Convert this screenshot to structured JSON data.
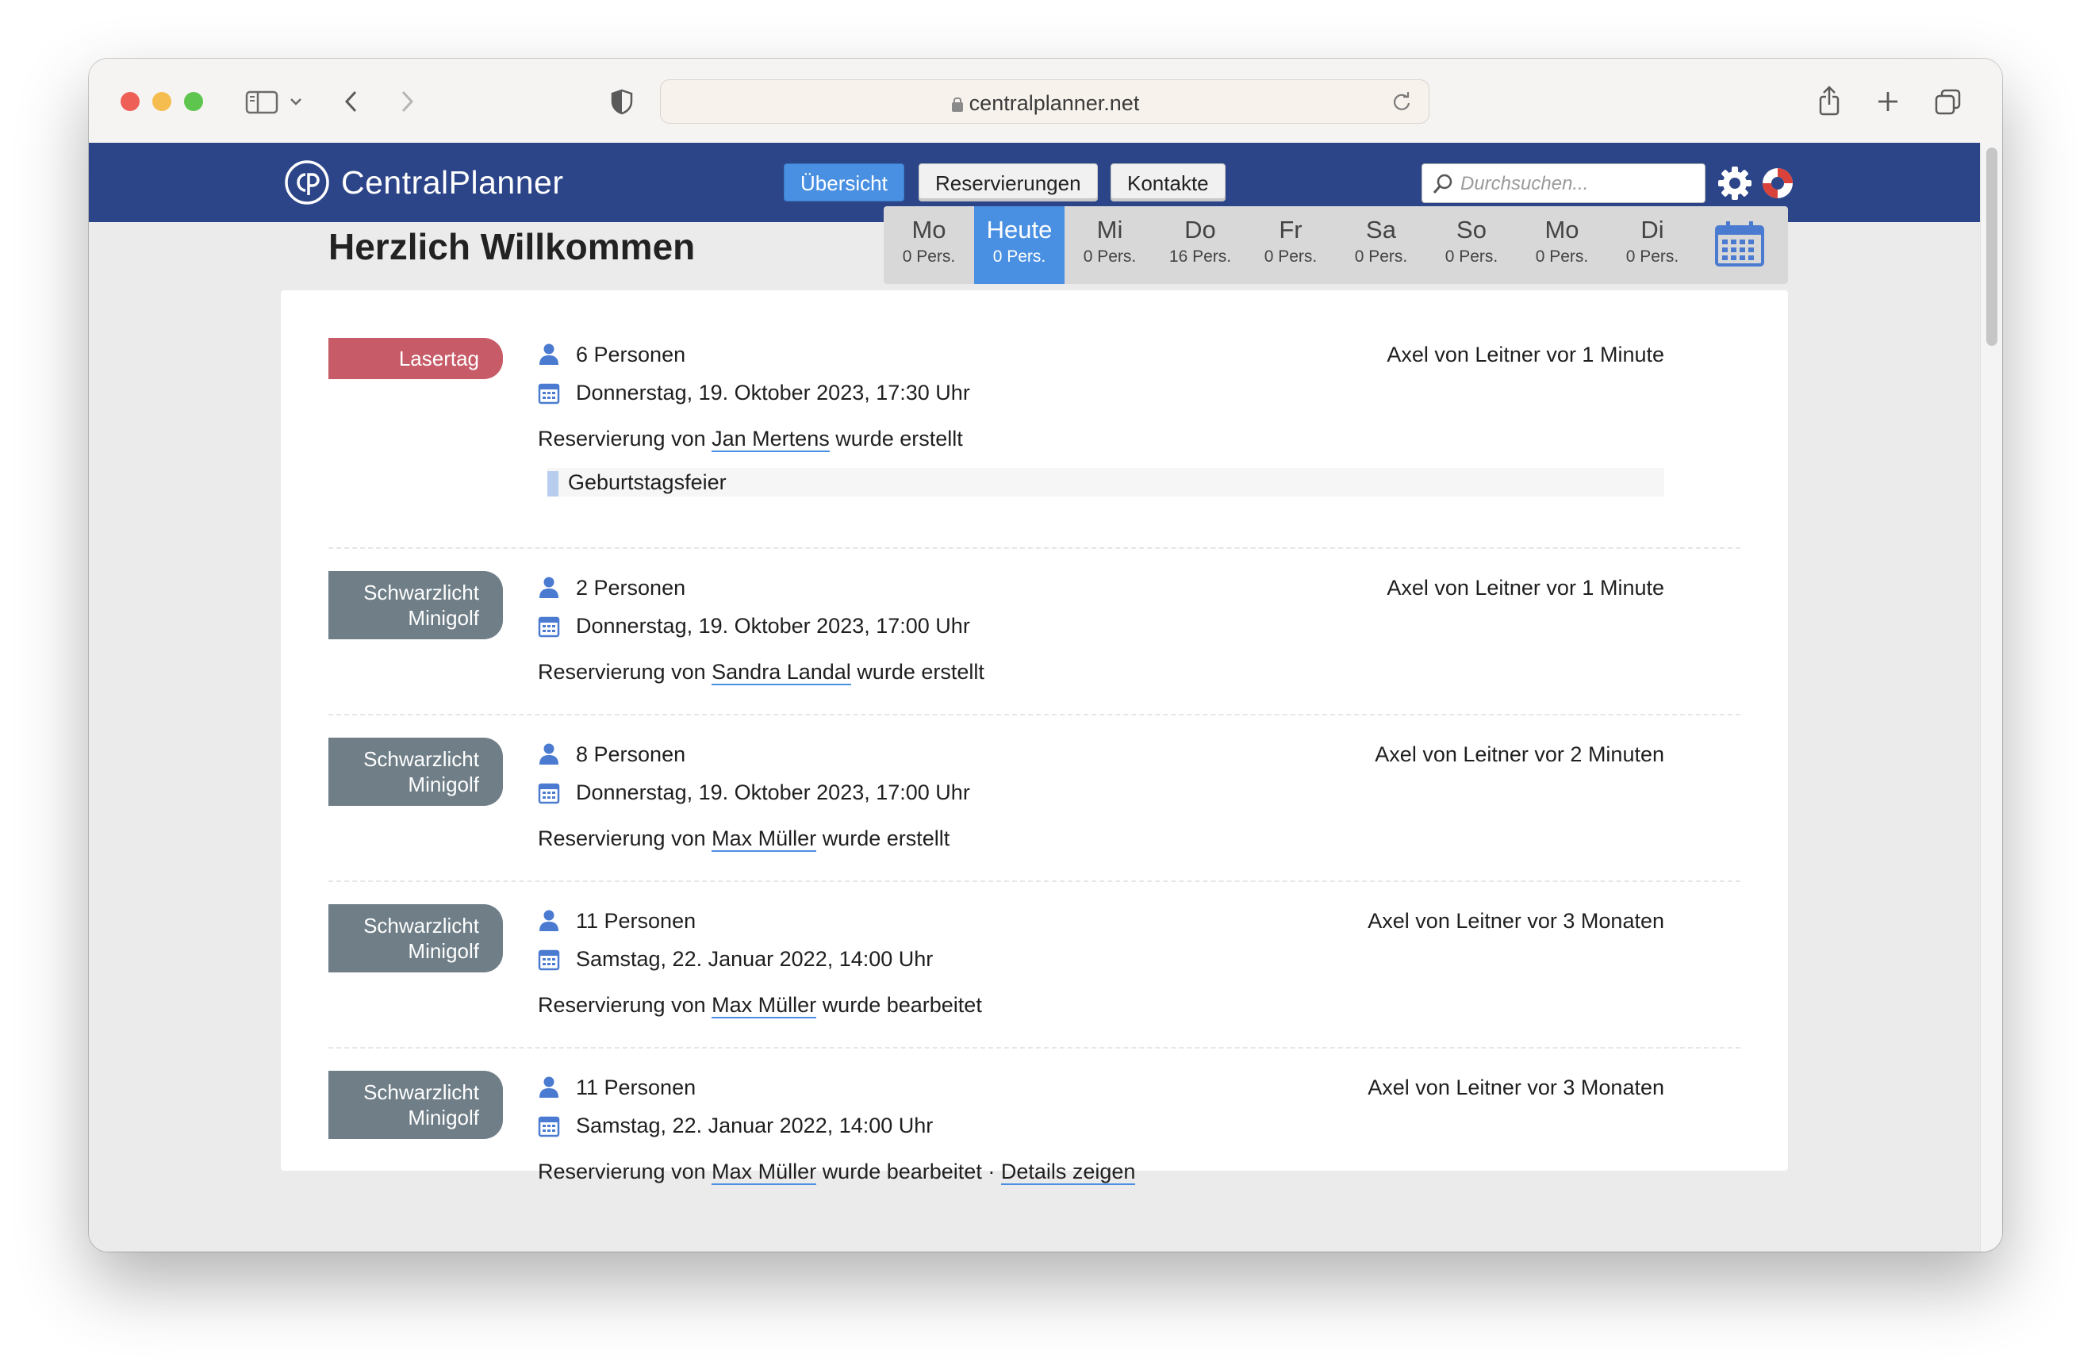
{
  "browser": {
    "url": "centralplanner.net"
  },
  "app": {
    "name": "CentralPlanner",
    "nav": [
      {
        "label": "Übersicht",
        "active": true
      },
      {
        "label": "Reservierungen",
        "active": false
      },
      {
        "label": "Kontakte",
        "active": false
      }
    ],
    "search_placeholder": "Durchsuchen..."
  },
  "page": {
    "title": "Herzlich Willkommen"
  },
  "days": [
    {
      "name": "Mo",
      "count": "0 Pers.",
      "today": false
    },
    {
      "name": "Heute",
      "count": "0 Pers.",
      "today": true
    },
    {
      "name": "Mi",
      "count": "0 Pers.",
      "today": false
    },
    {
      "name": "Do",
      "count": "16 Pers.",
      "today": false
    },
    {
      "name": "Fr",
      "count": "0 Pers.",
      "today": false
    },
    {
      "name": "Sa",
      "count": "0 Pers.",
      "today": false
    },
    {
      "name": "So",
      "count": "0 Pers.",
      "today": false
    },
    {
      "name": "Mo",
      "count": "0 Pers.",
      "today": false
    },
    {
      "name": "Di",
      "count": "0 Pers.",
      "today": false
    }
  ],
  "colors": {
    "brand": "#2c4488",
    "accent": "#4a90e2",
    "tag_laser": "#c75c68",
    "tag_minigolf": "#6f7e87"
  },
  "icons": {
    "person": "person-icon",
    "calendar": "calendar-icon",
    "settings": "gear-icon",
    "help": "lifebuoy-icon",
    "search": "search-icon"
  },
  "entries": [
    {
      "tag_lines": [
        "Lasertag"
      ],
      "persons": "6 Personen",
      "date": "Donnerstag, 19. Oktober 2023, 17:30 Uhr",
      "author": "Axel von Leitner vor 1 Minute",
      "text_before": "Reservierung von",
      "contact": "Jan Mertens",
      "text_after": "wurde erstellt",
      "note": "Geburtstagsfeier"
    },
    {
      "tag_lines": [
        "Schwarzlicht",
        "Minigolf"
      ],
      "persons": "2 Personen",
      "date": "Donnerstag, 19. Oktober 2023, 17:00 Uhr",
      "author": "Axel von Leitner vor 1 Minute",
      "text_before": "Reservierung von",
      "contact": "Sandra Landal",
      "text_after": "wurde erstellt"
    },
    {
      "tag_lines": [
        "Schwarzlicht",
        "Minigolf"
      ],
      "persons": "8 Personen",
      "date": "Donnerstag, 19. Oktober 2023, 17:00 Uhr",
      "author": "Axel von Leitner vor 2 Minuten",
      "text_before": "Reservierung von",
      "contact": "Max Müller",
      "text_after": "wurde erstellt"
    },
    {
      "tag_lines": [
        "Schwarzlicht",
        "Minigolf"
      ],
      "persons": "11 Personen",
      "date": "Samstag, 22. Januar 2022, 14:00 Uhr",
      "author": "Axel von Leitner vor 3 Monaten",
      "text_before": "Reservierung von",
      "contact": "Max Müller",
      "text_after": "wurde bearbeitet"
    },
    {
      "tag_lines": [
        "Schwarzlicht",
        "Minigolf"
      ],
      "persons": "11 Personen",
      "date": "Samstag, 22. Januar 2022, 14:00 Uhr",
      "author": "Axel von Leitner vor 3 Monaten",
      "text_before": "Reservierung von",
      "contact": "Max Müller",
      "text_after": "wurde bearbeitet ·",
      "details_link": "Details zeigen"
    }
  ]
}
